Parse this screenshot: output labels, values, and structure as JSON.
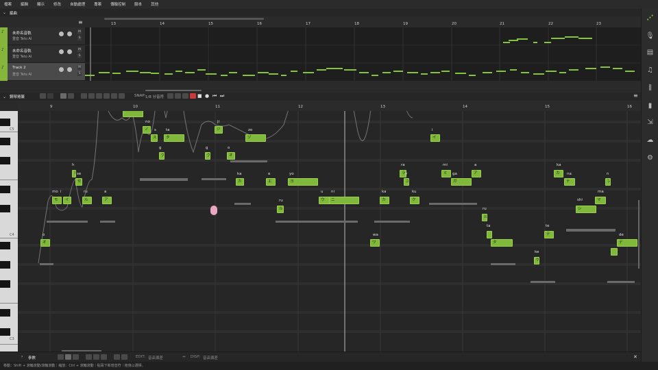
{
  "menu": [
    "檔案",
    "編輯",
    "顯示",
    "修改",
    "自動處理",
    "專案",
    "傳輸控制",
    "腳本",
    "其他"
  ],
  "arrangement": {
    "title": "編曲",
    "bars": [
      "13",
      "14",
      "15",
      "16",
      "17",
      "18",
      "19",
      "20",
      "21",
      "22",
      "23"
    ],
    "tracks": [
      {
        "name": "未命名音軌",
        "voice": "重音 Teto AI"
      },
      {
        "name": "未命名音軌",
        "voice": "重音 Teto AI"
      },
      {
        "name": "Track 2",
        "voice": "重音 Teto AI"
      }
    ],
    "track_buttons": {
      "mute": "M",
      "solo": "S"
    }
  },
  "pianoroll": {
    "title": "鋼琴捲簾",
    "snap_label": "SNAP:",
    "snap_value": "1/8 分音符",
    "bars": [
      "9",
      "10",
      "11",
      "12",
      "13",
      "14",
      "15",
      "16"
    ],
    "octave_labels": [
      "C5",
      "C4",
      "C3"
    ],
    "notes": [
      {
        "lyric": "o",
        "kana": "オ"
      },
      {
        "lyric": "mo",
        "kana": "モ"
      },
      {
        "lyric": "i",
        "kana": "イ"
      },
      {
        "lyric": "h",
        "kana": "ヒ"
      },
      {
        "lyric": "se",
        "kana": "セ"
      },
      {
        "lyric": "ru",
        "kana": "ル"
      },
      {
        "lyric": "a",
        "kana": "ア"
      },
      {
        "lyric": "no",
        "kana": "ノ"
      },
      {
        "lyric": "s",
        "kana": "ス"
      },
      {
        "lyric": "ta",
        "kana": "タ"
      },
      {
        "lyric": "g",
        "kana": "グ"
      },
      {
        "lyric": "ji",
        "kana": "ジ"
      },
      {
        "lyric": "g",
        "kana": "グ"
      },
      {
        "lyric": "zo",
        "kana": "ゾ"
      },
      {
        "lyric": "o",
        "kana": "オ"
      },
      {
        "lyric": "ka",
        "kana": "カ"
      },
      {
        "lyric": "e",
        "kana": "エ"
      },
      {
        "lyric": "yo",
        "kana": "ヨ"
      },
      {
        "lyric": "ru",
        "kana": "ル"
      },
      {
        "lyric": "u",
        "kana": "ウ"
      },
      {
        "lyric": "ni",
        "kana": "ニ"
      },
      {
        "lyric": "wa",
        "kana": "ワ"
      },
      {
        "lyric": "ka",
        "kana": "カ"
      },
      {
        "lyric": "ra",
        "kana": "ラ"
      },
      {
        "lyric": "y",
        "kana": "ユ"
      },
      {
        "lyric": "ku",
        "kana": "ク"
      },
      {
        "lyric": "i",
        "kana": "イ"
      },
      {
        "lyric": "mi",
        "kana": "ミ"
      },
      {
        "lyric": "ga",
        "kana": "ガ"
      },
      {
        "lyric": "a",
        "kana": "ア"
      },
      {
        "lyric": "ru",
        "kana": "ル"
      },
      {
        "lyric": "ta",
        "kana": "タ"
      },
      {
        "lyric": "ka",
        "kana": "カ"
      },
      {
        "lyric": "na",
        "kana": "ナ"
      },
      {
        "lyric": "te",
        "kana": "テ"
      },
      {
        "lyric": "ke",
        "kana": "ケ"
      },
      {
        "lyric": "shi",
        "kana": "シ"
      },
      {
        "lyric": "ma",
        "kana": "マ"
      },
      {
        "lyric": "n",
        "kana": "ン"
      },
      {
        "lyric": "de",
        "kana": "デ"
      }
    ]
  },
  "params": {
    "title": "參數",
    "edit_label": "EDIT:",
    "edit_value": "音高偏差",
    "disp_label": "DISP:",
    "disp_value": "音高偏差"
  },
  "statusbar": "移動：Shift + 滾輪滾動/滾輪滾動｜縮放：Ctrl + 滾輪滾動｜點兩下新增音符｜拖曳以選擇。",
  "colors": {
    "note": "#7fb83a",
    "accent": "#85b53a",
    "bg": "#262626"
  }
}
